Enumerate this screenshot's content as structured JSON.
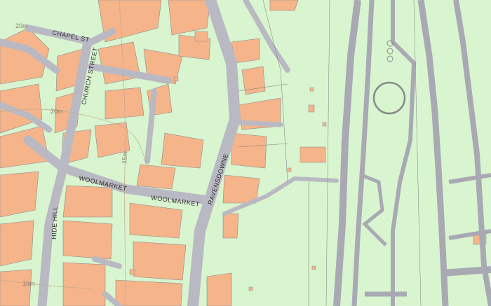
{
  "map": {
    "colors": {
      "land": "#d8f5cf",
      "building": "#f5b48a",
      "road": "#b9b9c3",
      "outline": "#6e6e6e",
      "contour": "#c6a98a",
      "label": "#2a2a2a"
    },
    "street_labels": {
      "chapel_st": "CHAPEL ST",
      "church_street": "CHURCH STREET",
      "woolmarket_west": "WOOLMARKET",
      "woolmarket_east": "WOOLMARKET",
      "ravensdowne": "RAVENSDOWNE",
      "hide_hill": "HIDE HILL"
    },
    "contour_labels": {
      "c20_top": "20m",
      "c20_mid": "20m",
      "c10_left": "10m",
      "c15_mid": "15m"
    }
  }
}
